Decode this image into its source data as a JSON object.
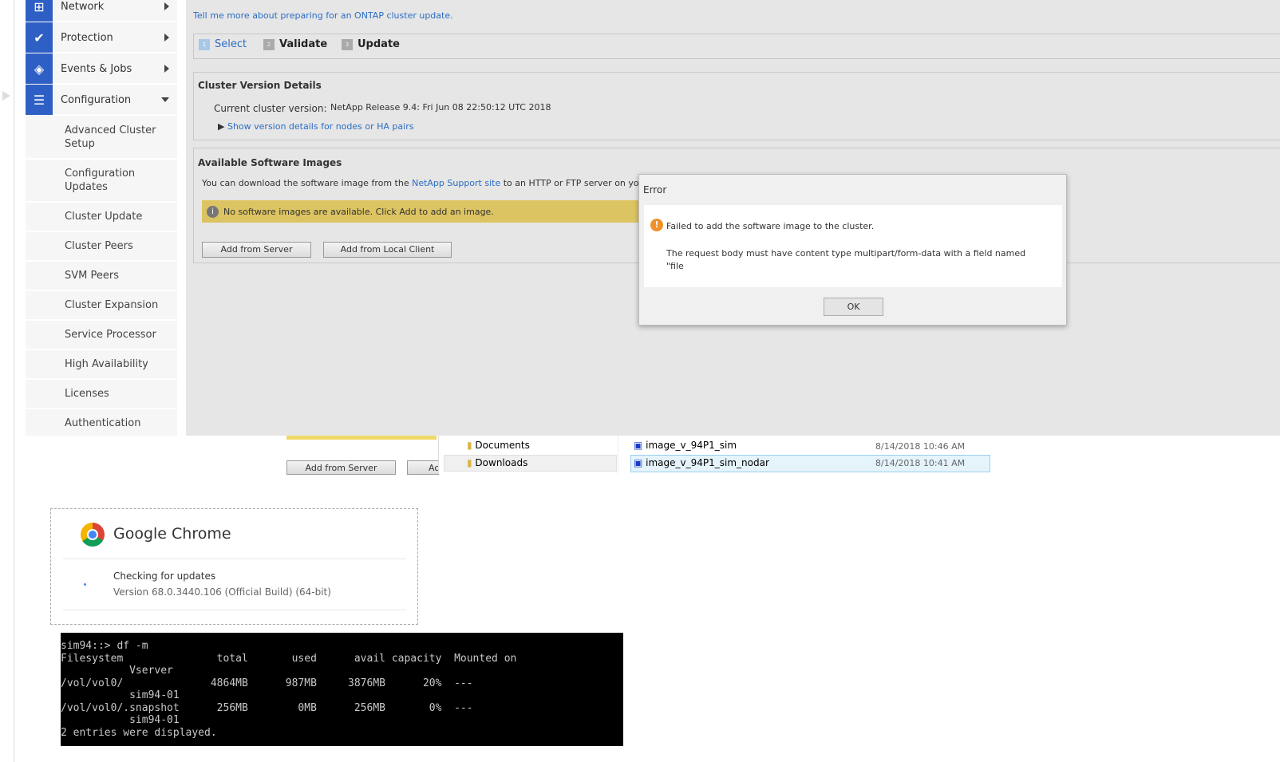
{
  "sidebar": {
    "items": [
      {
        "label": "Network",
        "icon": "network-icon"
      },
      {
        "label": "Protection",
        "icon": "shield-icon"
      },
      {
        "label": "Events & Jobs",
        "icon": "layers-icon"
      },
      {
        "label": "Configuration",
        "icon": "sliders-icon"
      }
    ],
    "sub_items": [
      "Advanced Cluster Setup",
      "Configuration Updates",
      "Cluster Update",
      "Cluster Peers",
      "SVM Peers",
      "Cluster Expansion",
      "Service Processor",
      "High Availability",
      "Licenses",
      "Authentication"
    ]
  },
  "main": {
    "help_link": "Tell me more about preparing for an ONTAP cluster update.",
    "steps": [
      {
        "num": "1",
        "label": "Select"
      },
      {
        "num": "2",
        "label": "Validate"
      },
      {
        "num": "3",
        "label": "Update"
      }
    ],
    "version": {
      "title": "Cluster Version Details",
      "label": "Current cluster version:",
      "value": "NetApp Release 9.4: Fri Jun 08 22:50:12 UTC 2018",
      "details_link": "Show version details for nodes or HA pairs"
    },
    "images": {
      "title": "Available Software Images",
      "desc_pre": "You can download the software image from the ",
      "desc_link": "NetApp Support site",
      "desc_post": " to an HTTP or FTP server on your networ",
      "notice": "No software images are available. Click Add to add an image.",
      "add_server": "Add from Server",
      "add_local": "Add from Local Client"
    }
  },
  "dialog": {
    "title": "Error",
    "message": "Failed to add the software image to the cluster.",
    "detail": "The request body must have content type multipart/form-data with a field named \"file",
    "ok": "OK"
  },
  "fragment": {
    "add_server": "Add from Server",
    "add_partial": "Ac",
    "folders": [
      "Documents",
      "Downloads"
    ],
    "files": [
      {
        "name": "image_v_94P1_sim",
        "date": "8/14/2018 10:46 AM"
      },
      {
        "name": "image_v_94P1_sim_nodar",
        "date": "8/14/2018 10:41 AM"
      }
    ]
  },
  "chrome": {
    "title": "Google Chrome",
    "status": "Checking for updates",
    "version": "Version 68.0.3440.106 (Official Build) (64-bit)"
  },
  "terminal": {
    "lines": [
      "sim94::> df -m",
      "Filesystem               total       used      avail capacity  Mounted on",
      "           Vserver",
      "/vol/vol0/              4864MB      987MB     3876MB      20%  ---",
      "           sim94-01",
      "/vol/vol0/.snapshot      256MB        0MB      256MB       0%  ---",
      "           sim94-01",
      "2 entries were displayed."
    ]
  }
}
